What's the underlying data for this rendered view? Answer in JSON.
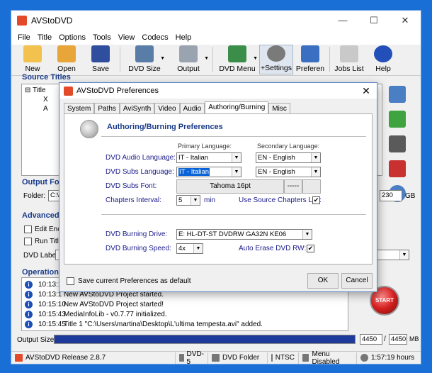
{
  "window": {
    "title": "AVStoDVD",
    "controls": [
      "—",
      "☐",
      "✕"
    ]
  },
  "menu": [
    "File",
    "Title",
    "Options",
    "Tools",
    "View",
    "Codecs",
    "Help"
  ],
  "toolbar": [
    {
      "label": "New",
      "icon": "folder-new-icon",
      "color": "#f2c14e"
    },
    {
      "label": "Open",
      "icon": "folder-open-icon",
      "color": "#e8a53a"
    },
    {
      "label": "Save",
      "icon": "floppy-disk-icon",
      "color": "#2f4f9e"
    },
    {
      "label": "DVD Size",
      "icon": "film-disc-icon",
      "color": "#5a7da8"
    },
    {
      "label": "Output",
      "icon": "disc-drive-icon",
      "color": "#9aa4b0"
    },
    {
      "label": "DVD Menu",
      "icon": "monitor-icon",
      "color": "#3a8e4a"
    },
    {
      "label": "+Settings",
      "icon": "gear-icon",
      "color": "#7a7a7a"
    },
    {
      "label": "Preferen",
      "icon": "preferences-icon",
      "color": "#3b6fc2"
    },
    {
      "label": "Jobs List",
      "icon": "list-icon",
      "color": "#c9c9c9"
    },
    {
      "label": "Help",
      "icon": "help-icon",
      "color": "#2250b8"
    }
  ],
  "groups": {
    "source_titles": "Source Titles",
    "output_folder": "Output Folde",
    "advanced": "Advanced P",
    "operations": "Operations"
  },
  "tree": {
    "item1": "Title",
    "item2": "X",
    "item3": "A"
  },
  "output": {
    "folder_label": "Folder:",
    "folder_value": "C:\\",
    "size_value": "230",
    "size_unit": "GB"
  },
  "advanced": {
    "edit_label": "Edit Enco",
    "run_label": "Run Title",
    "dvd_label": "DVD Label:",
    "dvd_value": ""
  },
  "log": [
    {
      "time": "10:13:1",
      "text": ""
    },
    {
      "time": "10:13:1",
      "text": "New AVStoDVD Project started."
    },
    {
      "time": "10:15:10",
      "text": "New AVStoDVD Project started!"
    },
    {
      "time": "10:15:43",
      "text": "MediaInfoLib - v0.7.77 initialized."
    },
    {
      "time": "10:15:45",
      "text": "Title 1 \"C:\\Users\\martina\\Desktop\\L'ultima tempesta.avi\" added."
    }
  ],
  "output_size": {
    "label": "Output Size",
    "value": "4450",
    "max": "4450",
    "unit": "MB",
    "fill_fraction": 1.0
  },
  "start_label": "START",
  "status": [
    {
      "text": "AVStoDVD Release 2.8.7",
      "icon": "app-icon"
    },
    {
      "text": "DVD-5",
      "icon": "disc-icon"
    },
    {
      "text": "DVD Folder",
      "icon": "folder-icon"
    },
    {
      "text": "NTSC",
      "icon": "tv-icon"
    },
    {
      "text": "Menu Disabled",
      "icon": "menu-icon"
    },
    {
      "text": "1:57:19 hours",
      "icon": "clock-icon"
    }
  ],
  "dialog": {
    "title": "AVStoDVD Preferences",
    "tabs": [
      "System",
      "Paths",
      "AviSynth",
      "Video",
      "Audio",
      "Authoring/Burning",
      "Misc"
    ],
    "active_tab": "Authoring/Burning",
    "section_title": "Authoring/Burning Preferences",
    "primary_lang_head": "Primary Language:",
    "secondary_lang_head": "Secondary Language:",
    "audio_lang_label": "DVD Audio Language:",
    "audio_lang_primary": "IT - Italian",
    "audio_lang_secondary": "EN - English",
    "subs_lang_label": "DVD Subs Language:",
    "subs_lang_primary": "IT - Italian",
    "subs_lang_secondary": "EN - English",
    "subs_font_label": "DVD Subs Font:",
    "subs_font_value": "Tahoma 16pt",
    "subs_font_btn": "-----",
    "chapters_label": "Chapters Interval:",
    "chapters_value": "5",
    "chapters_unit": "min",
    "use_source_chapters_label": "Use Source Chapters List:",
    "use_source_chapters": true,
    "burn_drive_label": "DVD Burning Drive:",
    "burn_drive_value": "E: HL-DT-ST DVDRW  GA32N KE06",
    "burn_speed_label": "DVD Burning Speed:",
    "burn_speed_value": "4x",
    "auto_erase_label": "Auto Erase DVD RW:",
    "auto_erase": true,
    "save_as_default_label": "Save current Preferences as default",
    "save_as_default": false,
    "ok_label": "OK",
    "cancel_label": "Cancel"
  }
}
